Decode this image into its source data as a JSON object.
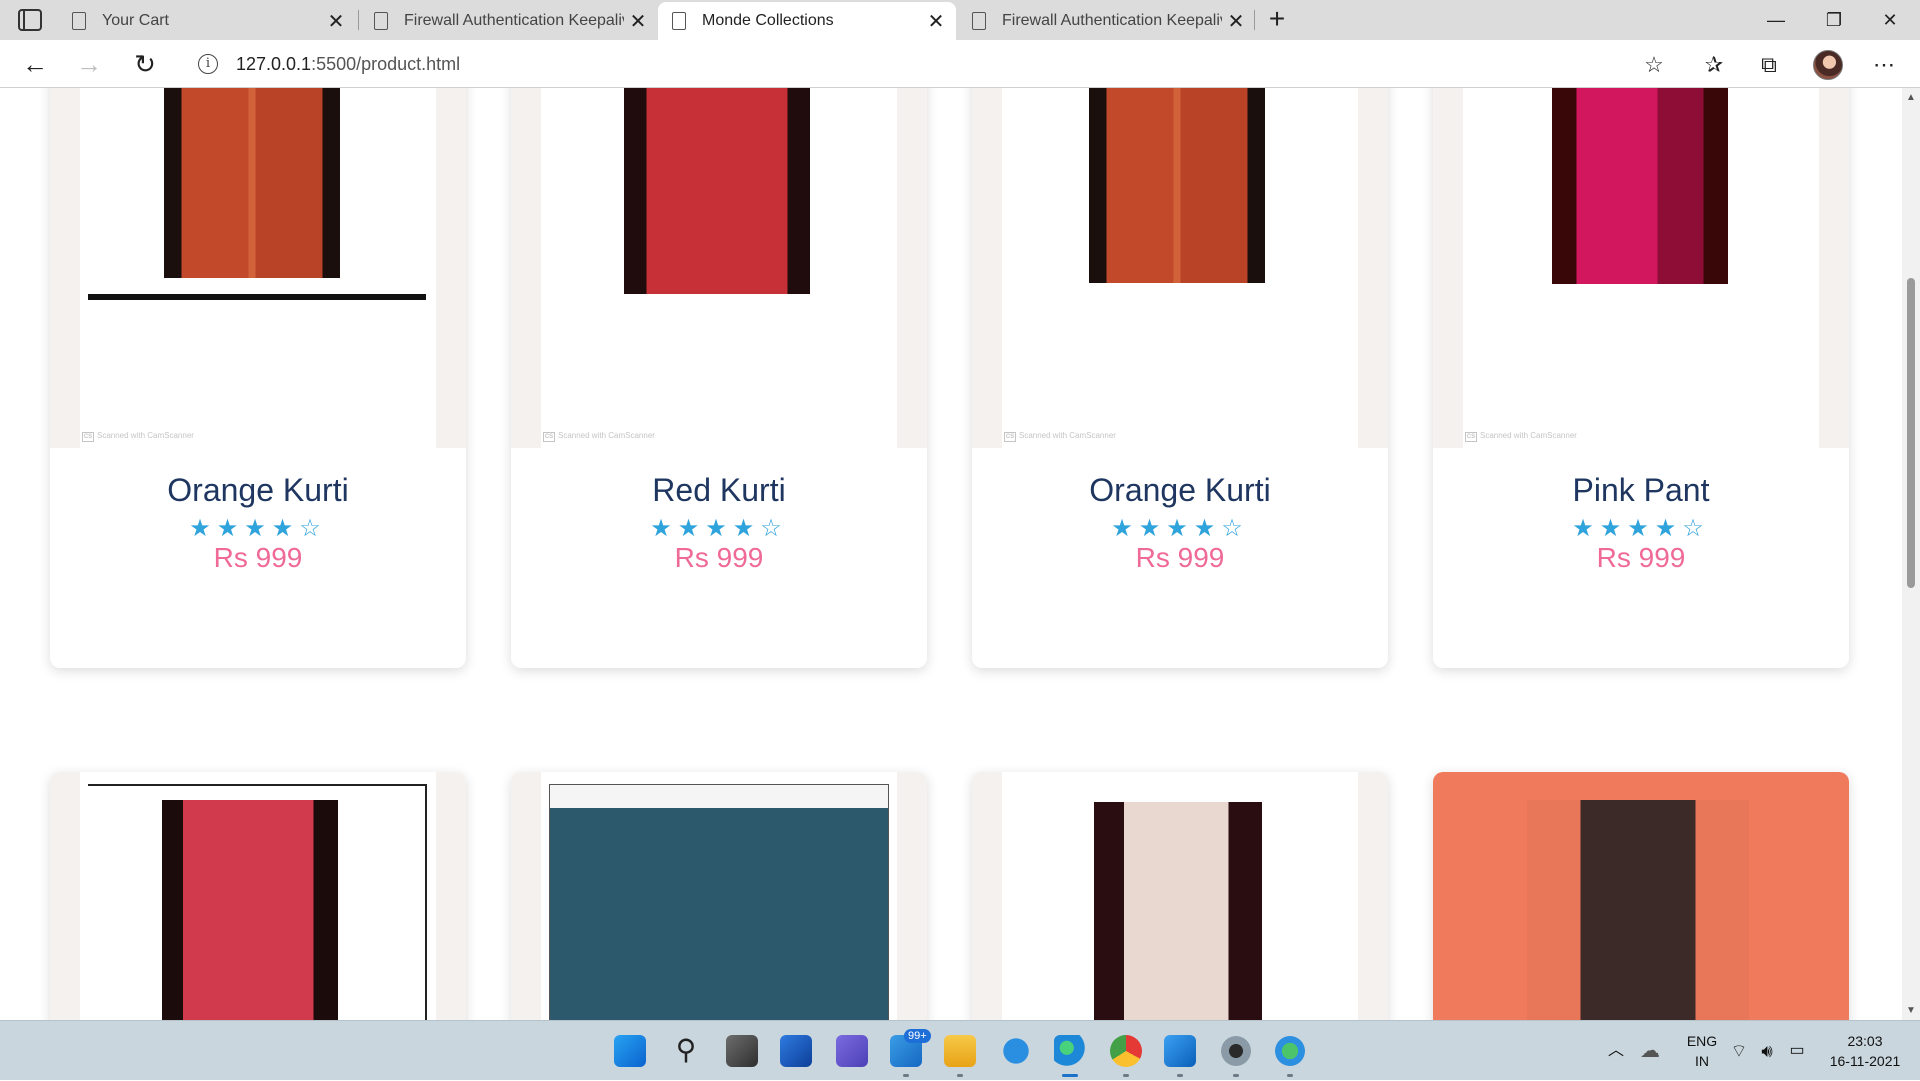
{
  "browser": {
    "tabs": [
      {
        "title": "Your Cart"
      },
      {
        "title": "Firewall Authentication Keepalive"
      },
      {
        "title": "Monde Collections"
      },
      {
        "title": "Firewall Authentication Keepalive"
      }
    ],
    "active_tab": 2,
    "url_host": "127.0.0.1",
    "url_path": ":5500/product.html"
  },
  "products": [
    {
      "name": "Orange Kurti",
      "rating": 4,
      "stars": "★★★★☆",
      "price": "Rs 999"
    },
    {
      "name": "Red Kurti",
      "rating": 4,
      "stars": "★★★★☆",
      "price": "Rs 999"
    },
    {
      "name": "Orange Kurti",
      "rating": 4,
      "stars": "★★★★☆",
      "price": "Rs 999"
    },
    {
      "name": "Pink Pant",
      "rating": 4,
      "stars": "★★★★☆",
      "price": "Rs 999"
    }
  ],
  "watermark": "Scanned with CamScanner",
  "watermark_badge": "CS",
  "taskbar": {
    "mail_badge": "99+",
    "lang_top": "ENG",
    "lang_bottom": "IN",
    "time": "23:03",
    "date": "16-11-2021"
  },
  "colors": {
    "product_name": "#1e3660",
    "stars": "#2fa3dc",
    "price": "#ef6a96"
  }
}
